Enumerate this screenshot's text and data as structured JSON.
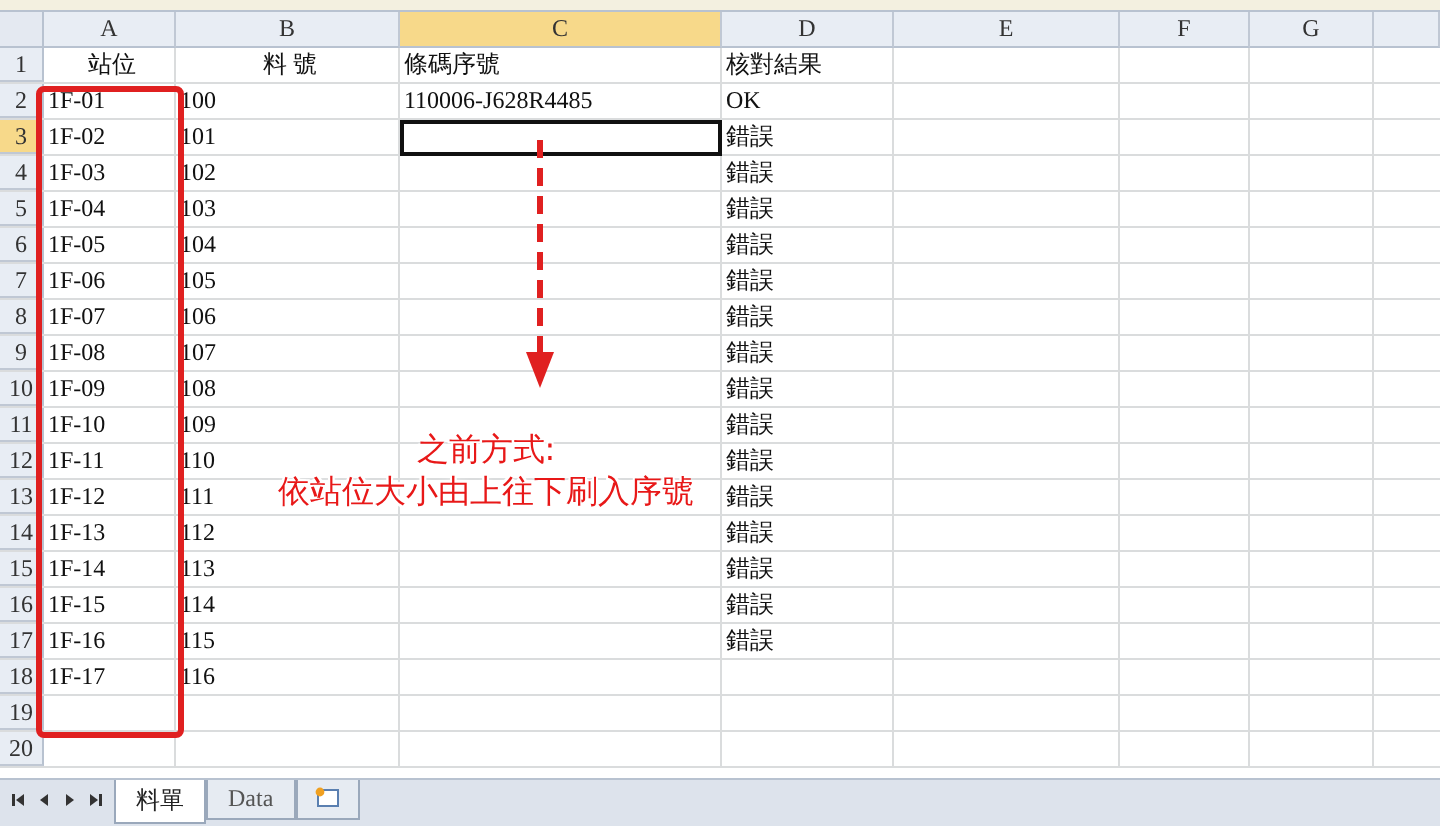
{
  "columns": [
    {
      "label": "A",
      "selected": false
    },
    {
      "label": "B",
      "selected": false
    },
    {
      "label": "C",
      "selected": true
    },
    {
      "label": "D",
      "selected": false
    },
    {
      "label": "E",
      "selected": false
    },
    {
      "label": "F",
      "selected": false
    },
    {
      "label": "G",
      "selected": false
    }
  ],
  "rows": [
    {
      "number": "1",
      "selected": false,
      "cells": {
        "A": "站位",
        "B": "料 號",
        "C": "條碼序號",
        "D": "核對結果"
      }
    },
    {
      "number": "2",
      "selected": false,
      "cells": {
        "A": "1F-01",
        "B": "100",
        "C": "110006-J628R4485",
        "D": "OK"
      }
    },
    {
      "number": "3",
      "selected": true,
      "cells": {
        "A": "1F-02",
        "B": "101",
        "D": "錯誤"
      }
    },
    {
      "number": "4",
      "selected": false,
      "cells": {
        "A": "1F-03",
        "B": "102",
        "D": "錯誤"
      }
    },
    {
      "number": "5",
      "selected": false,
      "cells": {
        "A": "1F-04",
        "B": "103",
        "D": "錯誤"
      }
    },
    {
      "number": "6",
      "selected": false,
      "cells": {
        "A": "1F-05",
        "B": "104",
        "D": "錯誤"
      }
    },
    {
      "number": "7",
      "selected": false,
      "cells": {
        "A": "1F-06",
        "B": "105",
        "D": "錯誤"
      }
    },
    {
      "number": "8",
      "selected": false,
      "cells": {
        "A": "1F-07",
        "B": "106",
        "D": "錯誤"
      }
    },
    {
      "number": "9",
      "selected": false,
      "cells": {
        "A": "1F-08",
        "B": "107",
        "D": "錯誤"
      }
    },
    {
      "number": "10",
      "selected": false,
      "cells": {
        "A": "1F-09",
        "B": "108",
        "D": "錯誤"
      }
    },
    {
      "number": "11",
      "selected": false,
      "cells": {
        "A": "1F-10",
        "B": "109",
        "D": "錯誤"
      }
    },
    {
      "number": "12",
      "selected": false,
      "cells": {
        "A": "1F-11",
        "B": "110",
        "D": "錯誤"
      }
    },
    {
      "number": "13",
      "selected": false,
      "cells": {
        "A": "1F-12",
        "B": "111",
        "D": "錯誤"
      }
    },
    {
      "number": "14",
      "selected": false,
      "cells": {
        "A": "1F-13",
        "B": "112",
        "D": "錯誤"
      }
    },
    {
      "number": "15",
      "selected": false,
      "cells": {
        "A": "1F-14",
        "B": "113",
        "D": "錯誤"
      }
    },
    {
      "number": "16",
      "selected": false,
      "cells": {
        "A": "1F-15",
        "B": "114",
        "D": "錯誤"
      }
    },
    {
      "number": "17",
      "selected": false,
      "cells": {
        "A": "1F-16",
        "B": "115",
        "D": "錯誤"
      }
    },
    {
      "number": "18",
      "selected": false,
      "cells": {
        "A": "1F-17",
        "B": "116"
      }
    },
    {
      "number": "19",
      "selected": false,
      "cells": {}
    },
    {
      "number": "20",
      "selected": false,
      "cells": {}
    }
  ],
  "annotation": {
    "lines": [
      "之前方式:",
      "依站位大小由上往下刷入序號"
    ]
  },
  "sheet_tabs": [
    {
      "label": "料單",
      "selected": true
    },
    {
      "label": "Data",
      "selected": false
    }
  ]
}
